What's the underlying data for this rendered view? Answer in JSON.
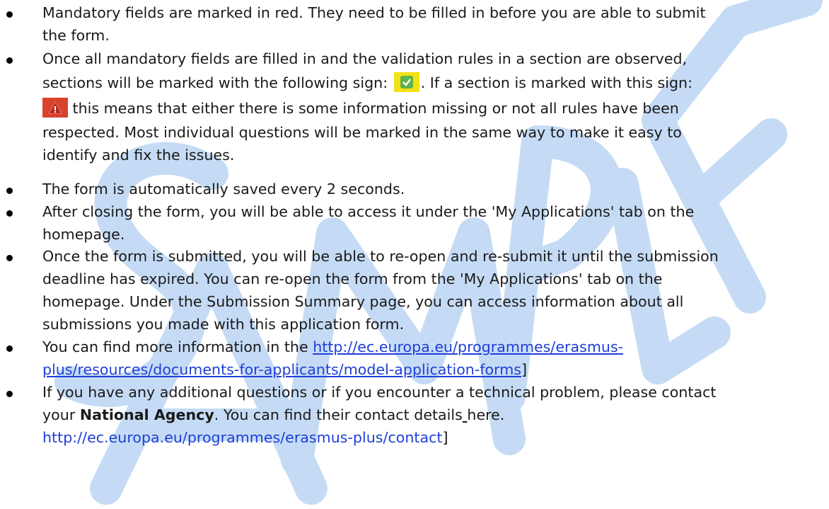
{
  "watermark": {
    "text": "SAMPLE",
    "color": "#c5dbf5"
  },
  "icons": {
    "check_badge": "check-badge-icon",
    "warning_badge": "warning-badge-icon",
    "bullet": "bullet-icon"
  },
  "items": {
    "mandatory": {
      "l1": "Mandatory fields are marked in red. They need to be filled in before you are able to submit",
      "l2": "the form."
    },
    "validation": {
      "l1": "Once all mandatory fields are filled in and the validation rules in a section are observed,",
      "l2a": "sections will be marked with the following sign: ",
      "l2b": ". If a section is marked with this sign:",
      "l3": " this means that either there is some information missing or not all rules have been",
      "l4": "respected. Most individual questions will be marked in the same way to make it easy to",
      "l5": "identify and fix the issues."
    },
    "autosave": {
      "l1": "The form is automatically saved every 2 seconds."
    },
    "after_close": {
      "l1": "After closing the form, you will be able to access it under the 'My Applications' tab on the",
      "l2": "homepage."
    },
    "resubmit": {
      "l1": "Once the form is submitted, you will be able to re-open and re-submit it until the submission",
      "l2": "deadline has expired. You can re-open the form from the 'My Applications' tab on the",
      "l3": "homepage. Under the Submission Summary page, you can access information about all",
      "l4": "submissions you made with this application form."
    },
    "more_info": {
      "prefix": "You can find more information in the ",
      "link_l1": "http://ec.europa.eu/programmes/erasmus-",
      "link_l2": "plus/resources/documents-for-applicants/model-application-forms",
      "suffix": "]"
    },
    "contact": {
      "l1": "If you have any additional questions or if you encounter a technical problem, please contact",
      "l2_prefix": "your ",
      "l2_bold": "National Agency",
      "l2_mid": ". You can find their contact details",
      "l2_space": " ",
      "l2_end": "here.",
      "link": "http://ec.europa.eu/programmes/erasmus-plus/contact",
      "link_suffix": "]"
    }
  }
}
